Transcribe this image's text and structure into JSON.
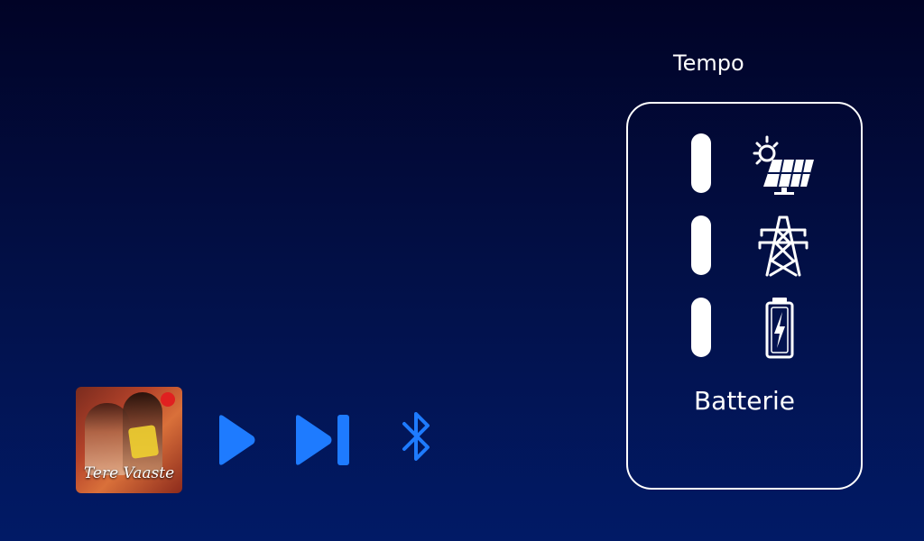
{
  "header": {
    "tempo_label": "Tempo"
  },
  "energy_panel": {
    "sources": [
      {
        "name": "solar",
        "icon": "solar-panel-icon"
      },
      {
        "name": "grid",
        "icon": "power-pylon-icon"
      },
      {
        "name": "battery",
        "icon": "battery-charging-icon"
      }
    ],
    "battery_label": "Batterie"
  },
  "media": {
    "track_title": "Tere Vaaste",
    "controls": {
      "play_icon": "play-icon",
      "next_icon": "skip-next-icon",
      "bluetooth_icon": "bluetooth-icon"
    }
  },
  "colors": {
    "background_top": "#010326",
    "background_bottom": "#011a66",
    "accent": "#1e7bff",
    "panel_border": "#ffffff"
  }
}
